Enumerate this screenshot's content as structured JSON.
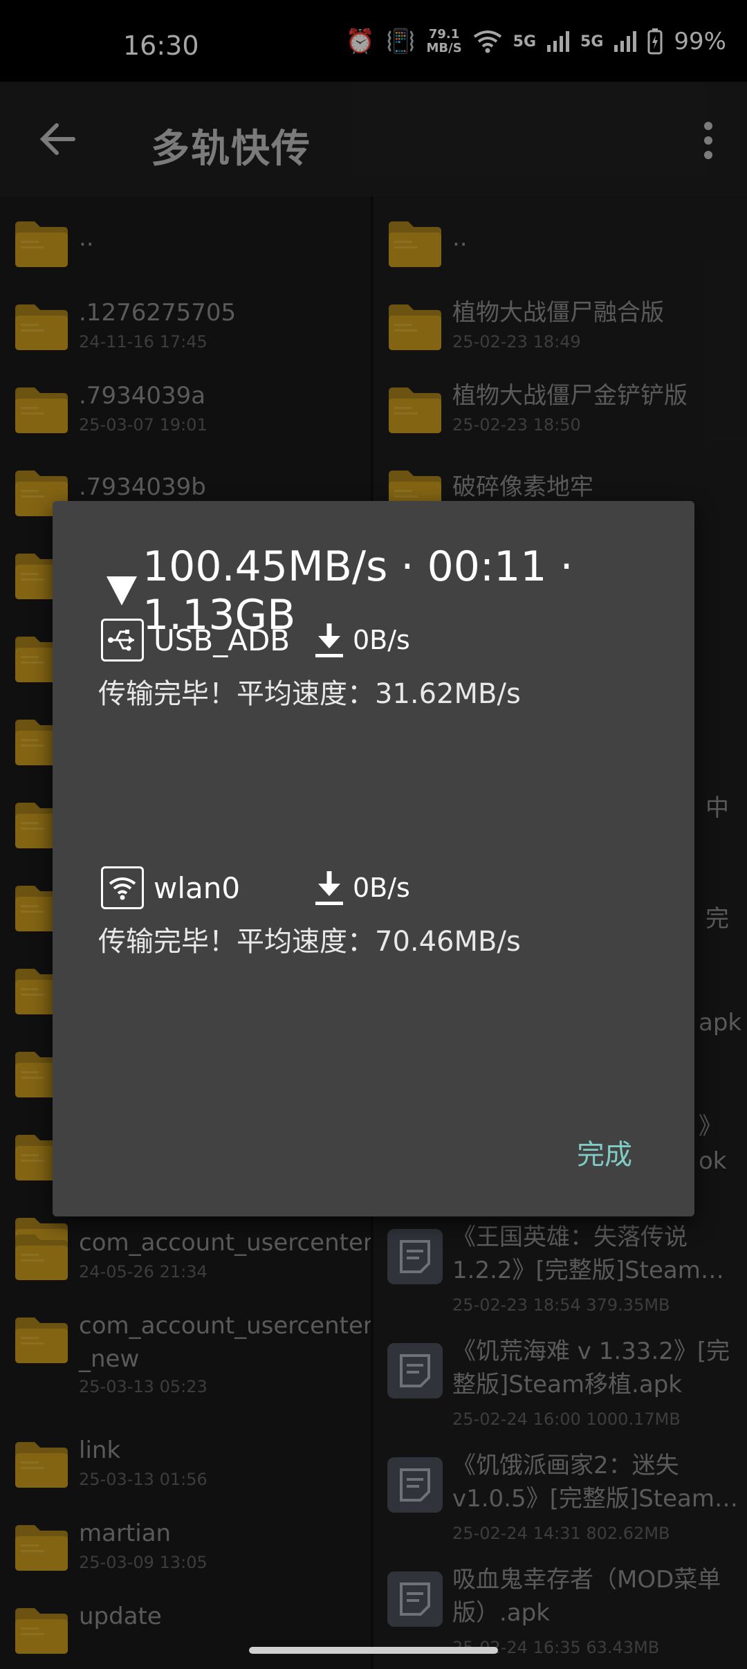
{
  "status": {
    "time": "16:30",
    "net_speed_top": "79.1",
    "net_speed_unit": "MB/S",
    "sig1": "5G",
    "sig2": "5G",
    "battery": "99%"
  },
  "appbar": {
    "title": "多轨快传"
  },
  "left_list": [
    {
      "name": "..",
      "date": ""
    },
    {
      "name": ".1276275705",
      "date": "24-11-16 17:45"
    },
    {
      "name": ".7934039a",
      "date": "25-03-07 19:01"
    },
    {
      "name": ".7934039b",
      "date": ""
    },
    {
      "name": "",
      "date": ""
    },
    {
      "name": "",
      "date": ""
    },
    {
      "name": "",
      "date": ""
    },
    {
      "name": "",
      "date": ""
    },
    {
      "name": "",
      "date": ""
    },
    {
      "name": "",
      "date": ""
    },
    {
      "name": "",
      "date": ""
    },
    {
      "name": "",
      "date": ""
    },
    {
      "name": "",
      "date": ""
    },
    {
      "name": "com_account_usercenter",
      "date": "24-05-26 21:34"
    },
    {
      "name": "com_account_usercenter _new",
      "date": "25-03-13 05:23"
    },
    {
      "name": "link",
      "date": "25-03-13 01:56"
    },
    {
      "name": "martian",
      "date": "25-03-09 13:05"
    },
    {
      "name": "update",
      "date": ""
    }
  ],
  "right_list": [
    {
      "name": "..",
      "date": ""
    },
    {
      "name": "植物大战僵尸融合版",
      "date": "25-02-23 18:49"
    },
    {
      "name": "植物大战僵尸金铲铲版",
      "date": "25-02-23 18:50"
    },
    {
      "name": "破碎像素地牢",
      "date": ""
    }
  ],
  "right_peek": [
    "中",
    "完",
    "apk",
    "》",
    "ok"
  ],
  "right_files": [
    {
      "name": "《王国英雄：失落传说 1.2.2》[完整版]Steam…",
      "date": "25-02-23 18:54  379.35MB"
    },
    {
      "name": "《饥荒海难 v 1.33.2》[完整版]Steam移植.apk",
      "date": "25-02-24 16:00  1000.17MB"
    },
    {
      "name": "《饥饿派画家2：迷失 v1.0.5》[完整版]Steam…",
      "date": "25-02-24 14:31  802.62MB"
    },
    {
      "name": "吸血鬼幸存者（MOD菜单版）.apk",
      "date": "25-02-24 16:35  63.43MB"
    }
  ],
  "dialog": {
    "header": "100.45MB/s · 00:11 · 1.13GB",
    "channels": [
      {
        "name": "USB_ADB",
        "speed": "0B/s",
        "status": "传输完毕！平均速度：31.62MB/s"
      },
      {
        "name": "wlan0",
        "speed": "0B/s",
        "status": "传输完毕！平均速度：70.46MB/s"
      }
    ],
    "done_label": "完成"
  },
  "colors": {
    "accent": "#80cbc4",
    "folder": "#c99a1e",
    "dialog_bg": "#424242"
  }
}
